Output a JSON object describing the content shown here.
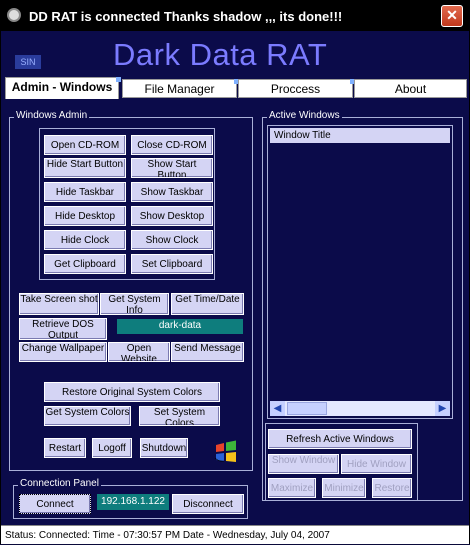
{
  "window": {
    "title": "DD RAT is connected Thanks shadow ,,, its done!!!",
    "close_glyph": "✕"
  },
  "banner": {
    "logo": "Dark Data RAT",
    "sin_label": "SIN"
  },
  "tabs": [
    {
      "label": "Admin - Windows",
      "active": true
    },
    {
      "label": "File Manager"
    },
    {
      "label": "Proccess"
    },
    {
      "label": "About"
    }
  ],
  "windows_admin": {
    "legend": "Windows Admin",
    "buttons": {
      "open_cd": "Open CD-ROM",
      "close_cd": "Close CD-ROM",
      "hide_start": "Hide Start Button",
      "show_start": "Show Start Button",
      "hide_taskbar": "Hide Taskbar",
      "show_taskbar": "Show Taskbar",
      "hide_desktop": "Hide Desktop",
      "show_desktop": "Show Desktop",
      "hide_clock": "Hide  Clock",
      "show_clock": "Show  Clock",
      "get_clipboard": "Get Clipboard",
      "set_clipboard": "Set Clipboard"
    }
  },
  "tools": {
    "take_screenshot": "Take Screen shot",
    "get_system_info": "Get System Info",
    "get_time_date": "Get Time/Date",
    "retrieve_dos": "Retrieve DOS Output",
    "output_value": "dark-data",
    "change_wallpaper": "Change Wallpaper",
    "open_website": "Open Website",
    "send_message": "Send Message",
    "restore_colors": "Restore Original System Colors",
    "get_system_colors": "Get System Colors",
    "set_system_colors": "Set System Colors",
    "restart": "Restart",
    "logoff": "Logoff",
    "shutdown": "Shutdown"
  },
  "active_windows": {
    "legend": "Active Windows",
    "column_header": "Window Title",
    "refresh": "Refresh Active Windows",
    "show_window": "Show Window",
    "hide_window": "Hide Window",
    "maximize": "Maximize",
    "minimize": "Minimize",
    "restore": "Restore"
  },
  "connection": {
    "legend": "Connection Panel",
    "connect": "Connect",
    "ip": "192.168.1.122",
    "disconnect": "Disconnect"
  },
  "status": {
    "text": "Status: Connected: Time - 07:30:57 PM Date - Wednesday, July 04, 2007"
  },
  "colors": {
    "background": "#0b0b4a",
    "logo": "#7b7bff",
    "button_face": "#d4d4f4",
    "ip_field": "#0e7d7d"
  },
  "icons": [
    "app-icon",
    "close-icon",
    "windows-flag-icon",
    "scroll-left-icon",
    "scroll-right-icon"
  ]
}
